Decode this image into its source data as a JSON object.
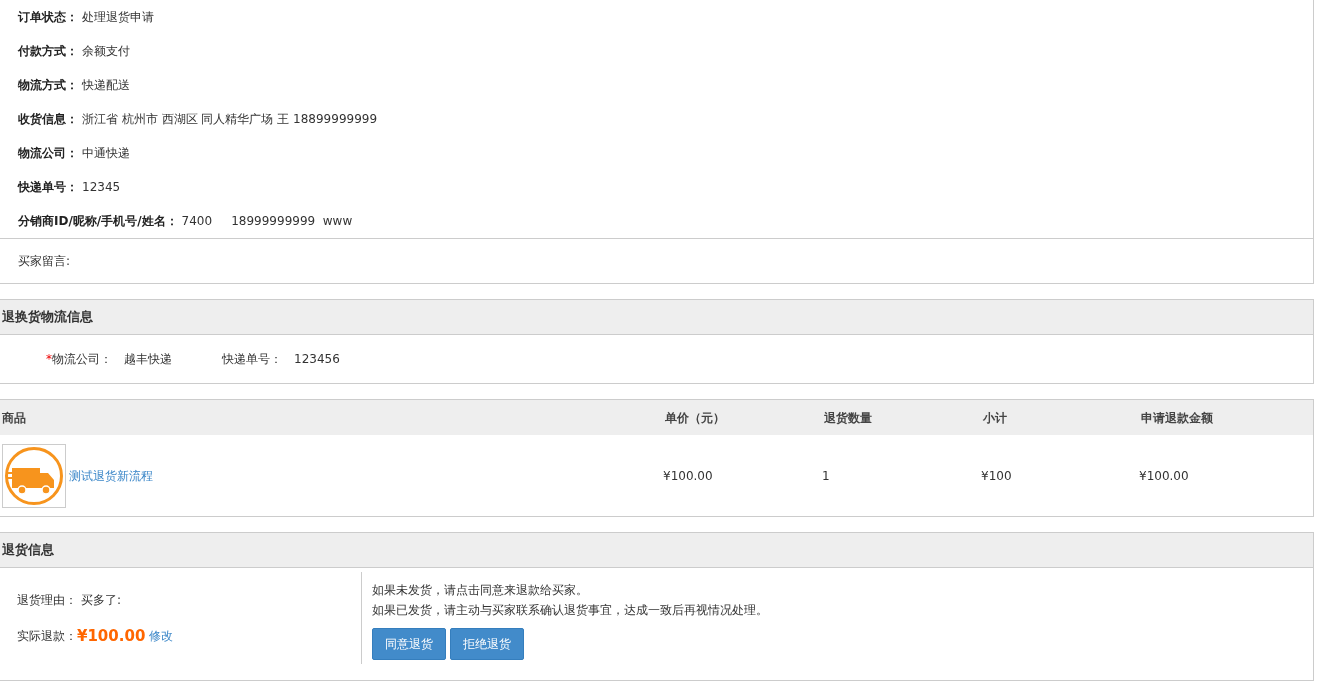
{
  "order_info": {
    "fields": [
      {
        "label": "订单状态：",
        "value": "处理退货申请"
      },
      {
        "label": "付款方式：",
        "value": "余额支付"
      },
      {
        "label": "物流方式：",
        "value": "快递配送"
      },
      {
        "label": "收货信息：",
        "value": "浙江省 杭州市 西湖区 同人精华广场 王 18899999999"
      },
      {
        "label": "物流公司：",
        "value": "中通快递"
      },
      {
        "label": "快递单号：",
        "value": "12345"
      },
      {
        "label": "分销商ID/昵称/手机号/姓名：",
        "value": "7400     18999999999  www"
      }
    ],
    "buyer_message_label": "买家留言:"
  },
  "return_logistics": {
    "title": "退换货物流信息",
    "fields": [
      {
        "required_mark": "*",
        "label": "物流公司：",
        "value": "越丰快递"
      },
      {
        "label": "快递单号：",
        "value": "123456"
      }
    ]
  },
  "goods_table": {
    "columns": [
      "商品",
      "单价（元）",
      "退货数量",
      "小计",
      "申请退款金额"
    ],
    "rows": [
      {
        "product": "测试退货新流程",
        "unit_price": "¥100.00",
        "quantity": "1",
        "subtotal": "¥100",
        "refund_amount": "¥100.00"
      }
    ]
  },
  "return_info": {
    "title": "退货信息",
    "reason_label": "退货理由：",
    "reason": "买多了:",
    "refund_label": "实际退款：",
    "refund_amount": "¥100.00",
    "edit_link": "修改",
    "notes": [
      "如果未发货，请点击同意来退款给买家。",
      "如果已发货，请主动与买家联系确认退货事宜，达成一致后再视情况处理。"
    ],
    "buttons": [
      "同意退货",
      "拒绝退货"
    ]
  }
}
